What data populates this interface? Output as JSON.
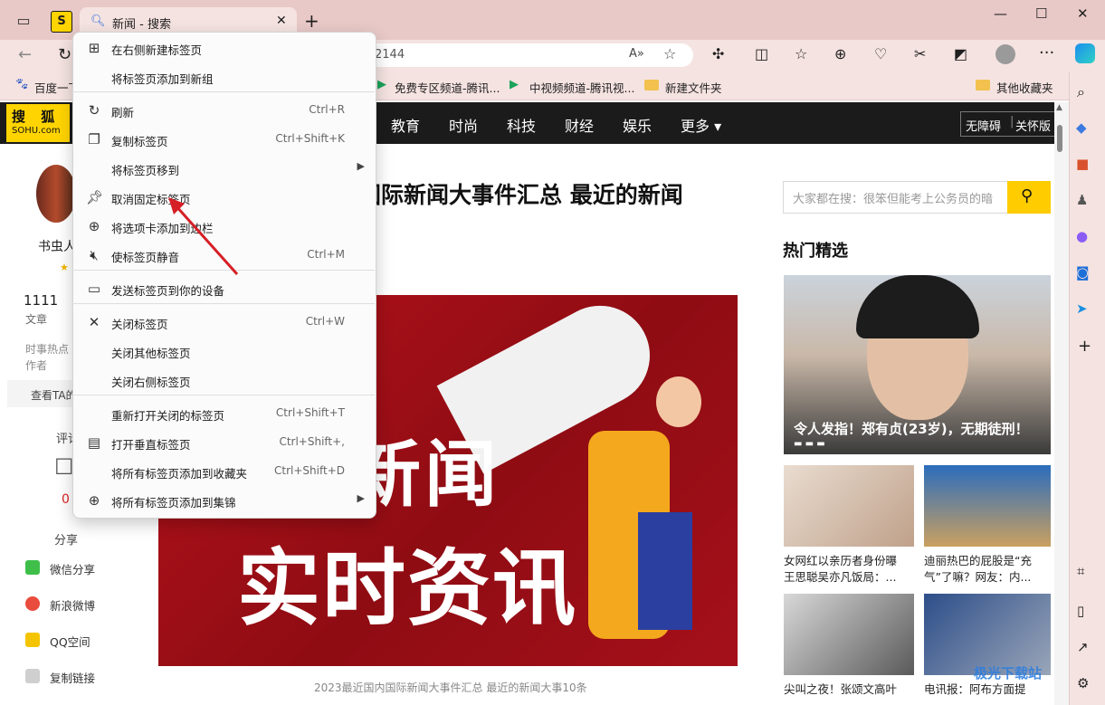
{
  "tab": {
    "title": "新闻 - 搜索"
  },
  "window": {
    "minimize": "—",
    "maximize": "☐",
    "close": "✕"
  },
  "address": {
    "url": "2144"
  },
  "bookmarks": {
    "items": [
      "百度一下",
      "免费专区频道-腾讯...",
      "中视频频道-腾讯视...",
      "新建文件夹"
    ],
    "other": "其他收藏夹"
  },
  "site": {
    "logo_line1": "搜 狐",
    "logo_line2": "SOHU.com",
    "nav": [
      "教育",
      "时尚",
      "科技",
      "财经",
      "娱乐",
      "更多 ▾"
    ],
    "accessibility": [
      "无障碍",
      "关怀版"
    ]
  },
  "author": {
    "name_partial": "书虫人",
    "article_count": "1111",
    "article_label": "文章",
    "desc1": "时事热点",
    "desc2": "作者",
    "view_link": "查看TA的",
    "comment_label": "评论",
    "share_label": "分享",
    "share_items": [
      "微信分享",
      "新浪微博",
      "QQ空间",
      "复制链接"
    ]
  },
  "article": {
    "title_partial": "国际新闻大事件汇总 最近的新闻",
    "banner_line1": "新闻",
    "banner_line2": "实时资讯",
    "caption": "2023最近国内国际新闻大事件汇总 最近的新闻大事10条"
  },
  "sidebar": {
    "search_placeholder": "大家都在搜：很笨但能考上公务员的暗",
    "hot_title": "热门精选",
    "top_story": "令人发指！郑有贞(23岁)，无期徒刑！",
    "items": [
      {
        "title1": "女网红以亲历者身份曝",
        "title2": "王思聪吴亦凡饭局：..."
      },
      {
        "title1": "迪丽热巴的屁股是“充",
        "title2": "气”了嘛？网友：内..."
      },
      {
        "title1": "尖叫之夜！张颂文高叶",
        "title2": ""
      },
      {
        "title1": "电讯报：阿布方面提",
        "title2": ""
      }
    ]
  },
  "context_menu": {
    "items": [
      {
        "label": "在右侧新建标签页",
        "shortcut": "",
        "icon": "new-tab-icon",
        "submenu": false
      },
      {
        "label": "将标签页添加到新组",
        "shortcut": "",
        "icon": "",
        "submenu": false
      },
      {
        "label": "刷新",
        "shortcut": "Ctrl+R",
        "icon": "refresh-icon",
        "submenu": false
      },
      {
        "label": "复制标签页",
        "shortcut": "Ctrl+Shift+K",
        "icon": "duplicate-icon",
        "submenu": false
      },
      {
        "label": "将标签页移到",
        "shortcut": "",
        "icon": "",
        "submenu": true
      },
      {
        "label": "取消固定标签页",
        "shortcut": "",
        "icon": "pin-icon",
        "submenu": false
      },
      {
        "label": "将选项卡添加到边栏",
        "shortcut": "",
        "icon": "sidebar-add-icon",
        "submenu": false
      },
      {
        "label": "使标签页静音",
        "shortcut": "Ctrl+M",
        "icon": "mute-icon",
        "submenu": false
      },
      {
        "label": "发送标签页到你的设备",
        "shortcut": "",
        "icon": "device-icon",
        "submenu": false
      },
      {
        "label": "关闭标签页",
        "shortcut": "Ctrl+W",
        "icon": "close-icon",
        "submenu": false
      },
      {
        "label": "关闭其他标签页",
        "shortcut": "",
        "icon": "",
        "submenu": false
      },
      {
        "label": "关闭右侧标签页",
        "shortcut": "",
        "icon": "",
        "submenu": false
      },
      {
        "label": "重新打开关闭的标签页",
        "shortcut": "Ctrl+Shift+T",
        "icon": "",
        "submenu": false
      },
      {
        "label": "打开垂直标签页",
        "shortcut": "Ctrl+Shift+,",
        "icon": "vertical-tabs-icon",
        "submenu": false
      },
      {
        "label": "将所有标签页添加到收藏夹",
        "shortcut": "Ctrl+Shift+D",
        "icon": "",
        "submenu": false
      },
      {
        "label": "将所有标签页添加到集锦",
        "shortcut": "",
        "icon": "collections-icon",
        "submenu": true
      }
    ]
  },
  "watermark": "极光下载站"
}
